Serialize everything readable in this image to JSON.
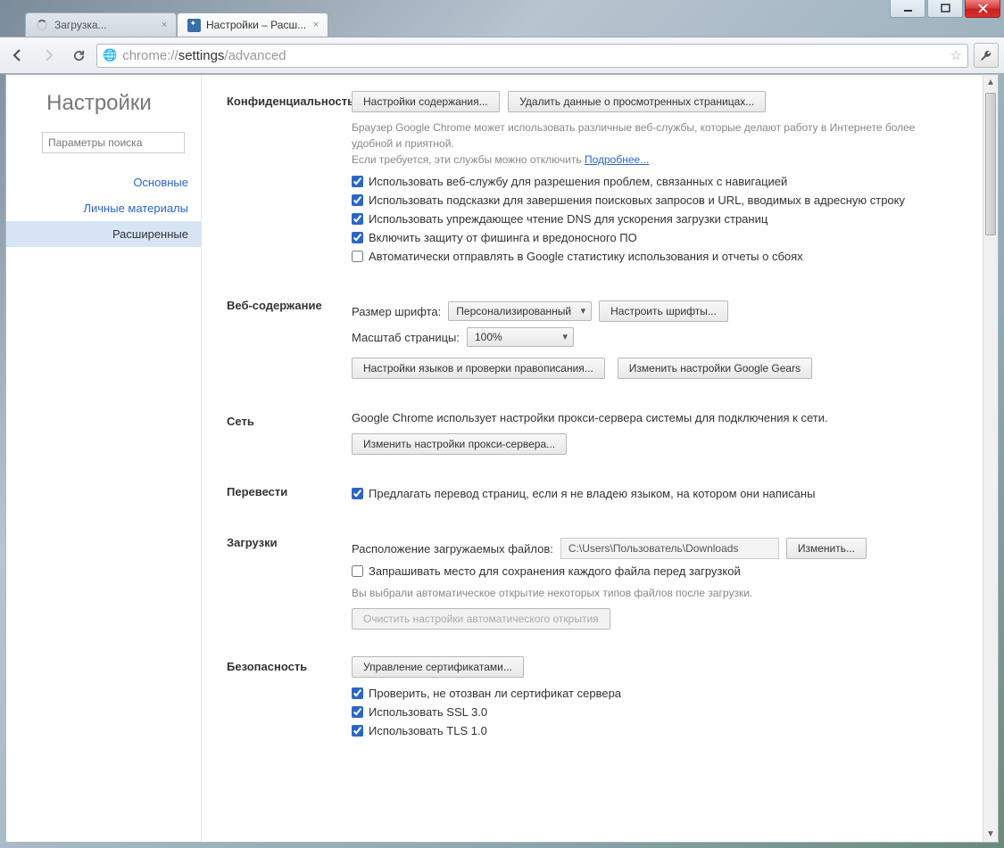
{
  "window": {
    "tabs": [
      {
        "label": "Загрузка...",
        "active": false
      },
      {
        "label": "Настройки – Расш...",
        "active": true
      }
    ],
    "url_prefix": "chrome://",
    "url_host": "settings",
    "url_path": "/advanced"
  },
  "sidebar": {
    "title": "Настройки",
    "search_placeholder": "Параметры поиска",
    "items": [
      {
        "label": "Основные",
        "selected": false
      },
      {
        "label": "Личные материалы",
        "selected": false
      },
      {
        "label": "Расширенные",
        "selected": true
      }
    ]
  },
  "sections": {
    "privacy": {
      "title": "Конфиденциальность",
      "btn_content": "Настройки содержания...",
      "btn_clear": "Удалить данные о просмотренных страницах...",
      "desc1": "Браузер Google Chrome может использовать различные веб-службы, которые делают работу в Интернете более удобной и приятной.",
      "desc2": "Если требуется, эти службы можно отключить ",
      "more": "Подробнее...",
      "checks": [
        {
          "label": "Использовать веб-службу для разрешения проблем, связанных с навигацией",
          "checked": true
        },
        {
          "label": "Использовать подсказки для завершения поисковых запросов и URL, вводимых в адресную строку",
          "checked": true
        },
        {
          "label": "Использовать упреждающее чтение DNS для ускорения загрузки страниц",
          "checked": true
        },
        {
          "label": "Включить защиту от фишинга и вредоносного ПО",
          "checked": true
        },
        {
          "label": "Автоматически отправлять в Google статистику использования и отчеты о сбоях",
          "checked": false
        }
      ]
    },
    "webcontent": {
      "title": "Веб-содержание",
      "font_label": "Размер шрифта:",
      "font_value": "Персонализированный",
      "fonts_btn": "Настроить шрифты...",
      "zoom_label": "Масштаб страницы:",
      "zoom_value": "100%",
      "lang_btn": "Настройки языков и проверки правописания...",
      "gears_btn": "Изменить настройки Google Gears"
    },
    "network": {
      "title": "Сеть",
      "desc": "Google Chrome использует настройки прокси-сервера системы для подключения к сети.",
      "proxy_btn": "Изменить настройки прокси-сервера..."
    },
    "translate": {
      "title": "Перевести",
      "check_label": "Предлагать перевод страниц, если я не владею языком, на котором они написаны"
    },
    "downloads": {
      "title": "Загрузки",
      "location_label": "Расположение загружаемых файлов:",
      "path": "C:\\Users\\Пользователь\\Downloads",
      "change_btn": "Изменить...",
      "ask_label": "Запрашивать место для сохранения каждого файла перед загрузкой",
      "auto_desc": "Вы выбрали автоматическое открытие некоторых типов файлов после загрузки.",
      "clear_btn": "Очистить настройки автоматического открытия"
    },
    "security": {
      "title": "Безопасность",
      "certs_btn": "Управление сертификатами...",
      "checks": [
        {
          "label": "Проверить, не отозван ли сертификат сервера",
          "checked": true
        },
        {
          "label": "Использовать SSL 3.0",
          "checked": true
        },
        {
          "label": "Использовать TLS 1.0",
          "checked": true
        }
      ]
    }
  }
}
